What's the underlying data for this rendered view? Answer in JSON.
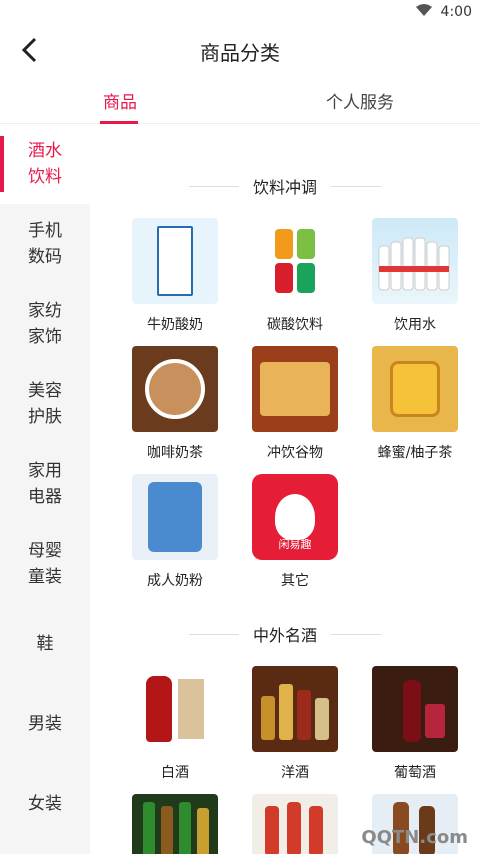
{
  "status": {
    "time": "4:00"
  },
  "header": {
    "title": "商品分类"
  },
  "tabs": [
    {
      "label": "商品",
      "active": true
    },
    {
      "label": "个人服务",
      "active": false
    }
  ],
  "sidebar": [
    {
      "label": "酒水饮料",
      "active": true
    },
    {
      "label": "手机数码"
    },
    {
      "label": "家纺家饰"
    },
    {
      "label": "美容护肤"
    },
    {
      "label": "家用电器"
    },
    {
      "label": "母婴童装"
    },
    {
      "label": "鞋"
    },
    {
      "label": "男装"
    },
    {
      "label": "女装"
    }
  ],
  "sections": [
    {
      "title": "饮料冲调",
      "items": [
        {
          "label": "牛奶酸奶",
          "icon": "milk-carton"
        },
        {
          "label": "碳酸饮料",
          "icon": "soda-cans"
        },
        {
          "label": "饮用水",
          "icon": "water-bottles"
        },
        {
          "label": "咖啡奶茶",
          "icon": "coffee-cup"
        },
        {
          "label": "冲饮谷物",
          "icon": "cereal-drink"
        },
        {
          "label": "蜂蜜/柚子茶",
          "icon": "honey-jar"
        },
        {
          "label": "成人奶粉",
          "icon": "milk-powder-can"
        },
        {
          "label": "其它",
          "icon": "bunny-app"
        }
      ]
    },
    {
      "title": "中外名酒",
      "items": [
        {
          "label": "白酒",
          "icon": "baijiu-bottle"
        },
        {
          "label": "洋酒",
          "icon": "liquor-bottles"
        },
        {
          "label": "葡萄酒",
          "icon": "wine-bottle"
        },
        {
          "label": "",
          "icon": "beer-bottles"
        },
        {
          "label": "",
          "icon": "red-bottles"
        },
        {
          "label": "",
          "icon": "brown-bottles"
        }
      ]
    }
  ],
  "misc": {
    "other_badge_text": "闲易趣",
    "watermark": "QQTN.com"
  }
}
